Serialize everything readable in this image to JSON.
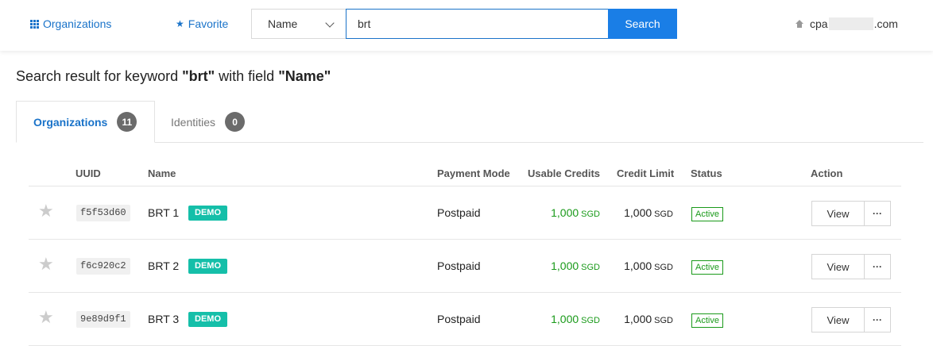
{
  "topbar": {
    "organizations_label": "Organizations",
    "favorite_label": "Favorite",
    "search_field": "Name",
    "search_value": "brt",
    "search_button": "Search",
    "account_prefix": "cpa",
    "account_suffix": ".com"
  },
  "heading": {
    "prefix": "Search result for keyword ",
    "keyword": "\"brt\"",
    "middle": " with field ",
    "field": "\"Name\""
  },
  "tabs": [
    {
      "label": "Organizations",
      "count": "11"
    },
    {
      "label": "Identities",
      "count": "0"
    }
  ],
  "table": {
    "headers": {
      "uuid": "UUID",
      "name": "Name",
      "payment_mode": "Payment Mode",
      "usable_credits": "Usable Credits",
      "credit_limit": "Credit Limit",
      "status": "Status",
      "action": "Action"
    },
    "rows": [
      {
        "uuid": "f5f53d60",
        "name": "BRT 1",
        "badge": "DEMO",
        "payment_mode": "Postpaid",
        "credits": "1,000",
        "credits_unit": "SGD",
        "limit": "1,000",
        "limit_unit": "SGD",
        "status": "Active",
        "view": "View",
        "more": "···"
      },
      {
        "uuid": "f6c920c2",
        "name": "BRT 2",
        "badge": "DEMO",
        "payment_mode": "Postpaid",
        "credits": "1,000",
        "credits_unit": "SGD",
        "limit": "1,000",
        "limit_unit": "SGD",
        "status": "Active",
        "view": "View",
        "more": "···"
      },
      {
        "uuid": "9e89d9f1",
        "name": "BRT 3",
        "badge": "DEMO",
        "payment_mode": "Postpaid",
        "credits": "1,000",
        "credits_unit": "SGD",
        "limit": "1,000",
        "limit_unit": "SGD",
        "status": "Active",
        "view": "View",
        "more": "···"
      }
    ]
  },
  "icons": {
    "organizations": "grid-icon",
    "favorite": "star-icon",
    "account": "home-icon",
    "row_favorite": "star-icon"
  },
  "colors": {
    "accent": "#1a73c9",
    "search_button": "#1a7ee6",
    "demo_badge": "#15bfa9",
    "credit_green": "#1a9a1a",
    "count_badge": "#6b6b6b"
  }
}
